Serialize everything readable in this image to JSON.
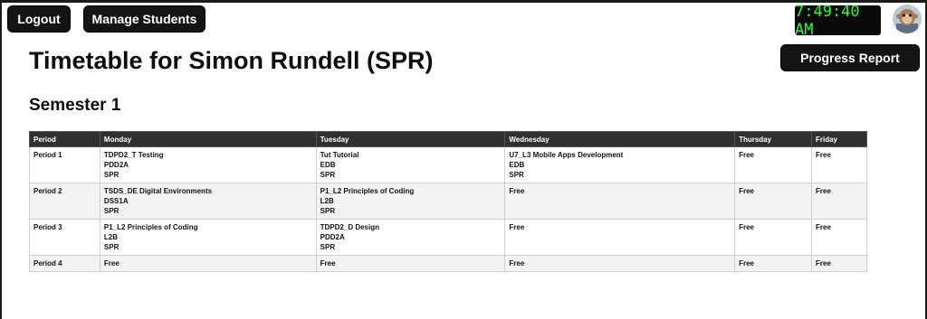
{
  "header": {
    "logout_label": "Logout",
    "manage_label": "Manage Students",
    "clock": "7:49:40 AM",
    "progress_label": "Progress Report"
  },
  "page": {
    "title": "Timetable for Simon Rundell (SPR)",
    "semester": "Semester 1"
  },
  "colors": {
    "button_bg": "#141414",
    "clock_text": "#35f23e",
    "table_header": "#303030"
  },
  "timetable": {
    "headers": [
      "Period",
      "Monday",
      "Tuesday",
      "Wednesday",
      "Thursday",
      "Friday"
    ],
    "rows": [
      {
        "period": "Period 1",
        "cells": [
          [
            "TDPD2_T Testing",
            "PDD2A",
            "SPR"
          ],
          [
            "Tut Tutorial",
            "EDB",
            "SPR"
          ],
          [
            "U7_L3 Mobile Apps Development",
            "EDB",
            "SPR"
          ],
          [
            "Free"
          ],
          [
            "Free"
          ]
        ]
      },
      {
        "period": "Period 2",
        "cells": [
          [
            "TSDS_DE Digital Environments",
            "DSS1A",
            "SPR"
          ],
          [
            "P1_L2 Principles of Coding",
            "L2B",
            "SPR"
          ],
          [
            "Free"
          ],
          [
            "Free"
          ],
          [
            "Free"
          ]
        ]
      },
      {
        "period": "Period 3",
        "cells": [
          [
            "P1_L2 Principles of Coding",
            "L2B",
            "SPR"
          ],
          [
            "TDPD2_D Design",
            "PDD2A",
            "SPR"
          ],
          [
            "Free"
          ],
          [
            "Free"
          ],
          [
            "Free"
          ]
        ]
      },
      {
        "period": "Period 4",
        "cells": [
          [
            "Free"
          ],
          [
            "Free"
          ],
          [
            "Free"
          ],
          [
            "Free"
          ],
          [
            "Free"
          ]
        ]
      }
    ]
  }
}
